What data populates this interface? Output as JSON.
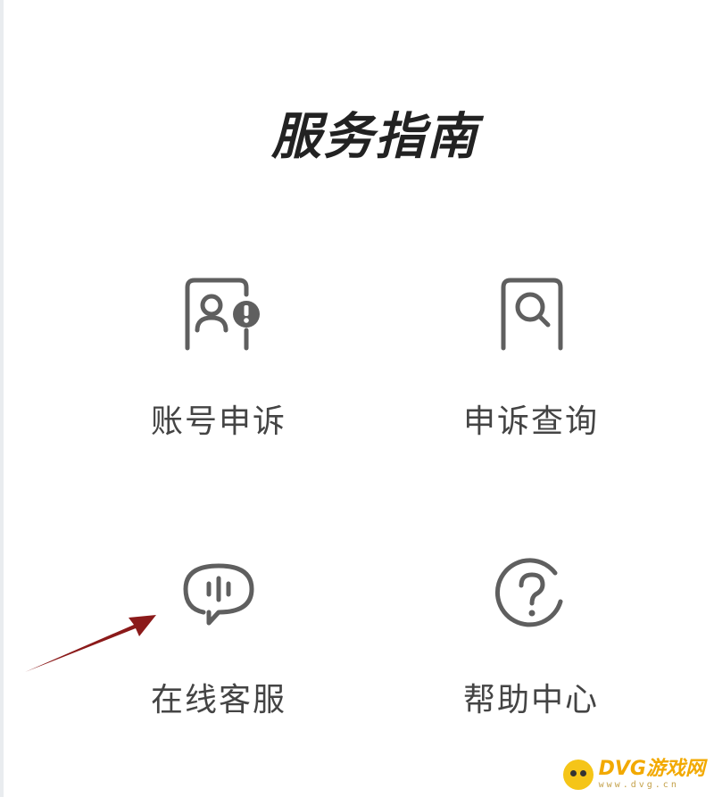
{
  "page": {
    "title": "服务指南"
  },
  "services": {
    "account_appeal": {
      "label": "账号申诉",
      "icon": "account-appeal-icon"
    },
    "appeal_query": {
      "label": "申诉查询",
      "icon": "appeal-search-icon"
    },
    "online_service": {
      "label": "在线客服",
      "icon": "chat-bubble-icon"
    },
    "help_center": {
      "label": "帮助中心",
      "icon": "question-circle-icon"
    }
  },
  "watermark": {
    "name": "DVG游戏网",
    "site": "www.dvg.cn"
  },
  "colors": {
    "icon_stroke": "#5f5f5f",
    "label_text": "#444444",
    "title_text": "#222222",
    "annotation_arrow": "#8b1a1a",
    "watermark_yellow": "#f5c518"
  }
}
